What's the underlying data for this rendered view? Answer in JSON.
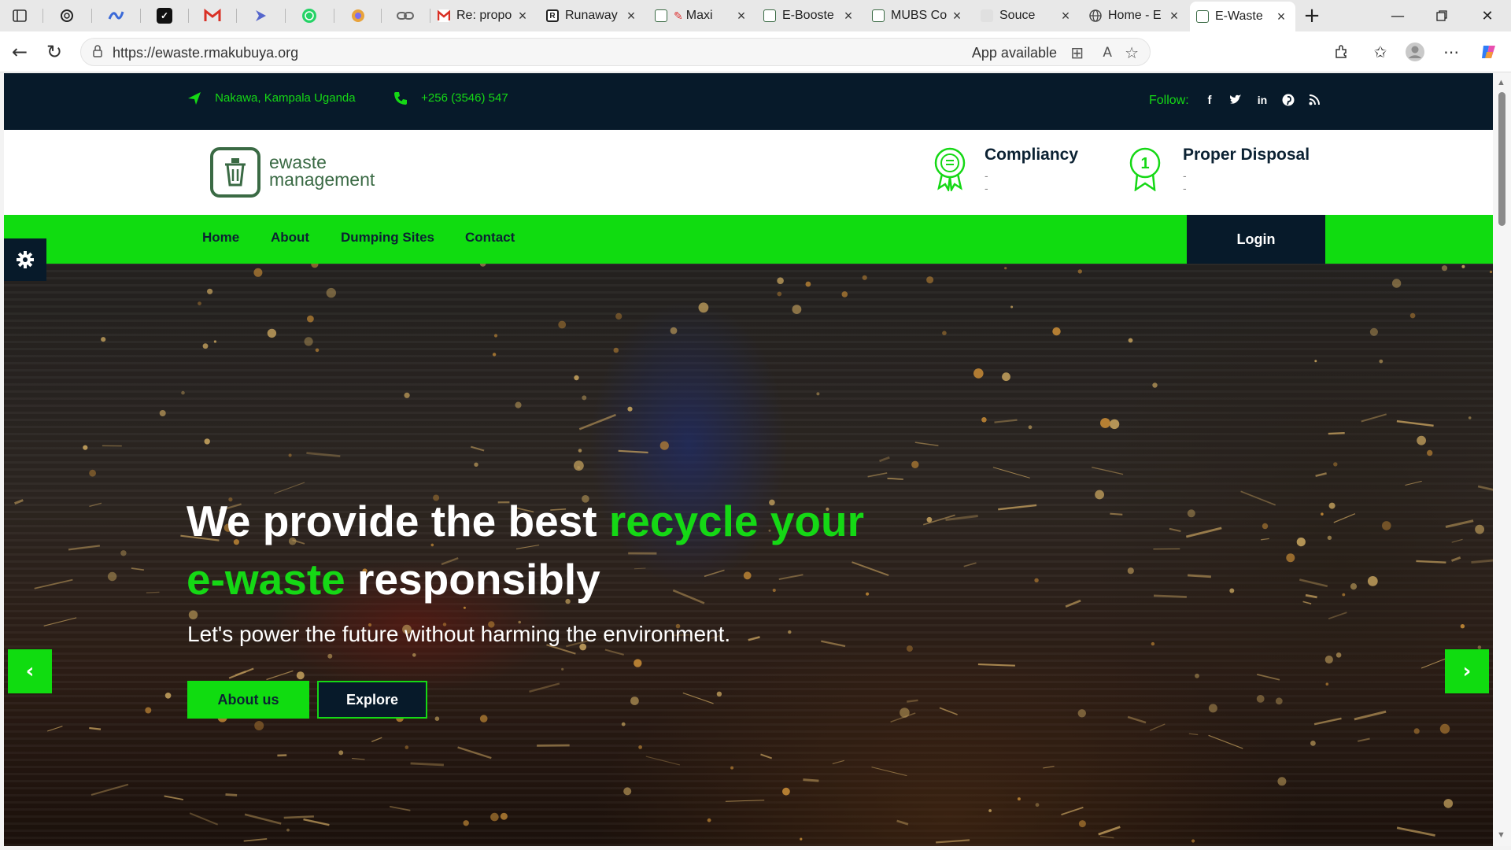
{
  "browser": {
    "pinned_tabs": [
      {
        "icon": "tabs-overview-icon",
        "color": "#444444"
      },
      {
        "icon": "chatgpt-icon",
        "color": "#222222"
      },
      {
        "icon": "copilot-app-icon",
        "color": "#3b6ad8"
      },
      {
        "icon": "ticktick-icon",
        "color": "#111111"
      },
      {
        "icon": "gmail-icon",
        "color": "#d93025"
      },
      {
        "icon": "arrow-app-icon",
        "color": "#5566cc"
      },
      {
        "icon": "whatsapp-icon",
        "color": "#25d366"
      },
      {
        "icon": "colorful-app-icon",
        "color": "#e8a33c"
      },
      {
        "icon": "link-app-icon",
        "color": "#777777"
      }
    ],
    "tabs": [
      {
        "title": "Re: propo",
        "icon": "gmail-icon",
        "color": "#d93025"
      },
      {
        "title": "Runaway",
        "icon": "runaway-icon",
        "color": "#222222"
      },
      {
        "title": "Maxi",
        "icon": "ewaste-favicon",
        "color": "#3a6a44"
      },
      {
        "title": "E-Booste",
        "icon": "ewaste-favicon",
        "color": "#3a6a44"
      },
      {
        "title": "MUBS Co",
        "icon": "ewaste-favicon",
        "color": "#3a6a44"
      },
      {
        "title": "Souce",
        "icon": "page-icon",
        "color": "#bbbbbb"
      },
      {
        "title": "Home - E",
        "icon": "globe-icon",
        "color": "#555555"
      },
      {
        "title": "E-Waste",
        "icon": "ewaste-favicon",
        "color": "#3a6a44",
        "active": true
      }
    ],
    "url": "https://ewaste.rmakubuya.org",
    "app_available": "App available"
  },
  "topbar": {
    "location": "Nakawa, Kampala Uganda",
    "phone": "+256 (3546) 547",
    "follow_label": "Follow:",
    "socials": [
      "facebook-icon",
      "twitter-icon",
      "linkedin-icon",
      "pinterest-icon",
      "rss-icon"
    ]
  },
  "header": {
    "logo_line1": "ewaste",
    "logo_line2": "management",
    "features": [
      {
        "title": "Compliancy",
        "sub": "--"
      },
      {
        "title": "Proper Disposal",
        "sub": "--"
      }
    ]
  },
  "nav": {
    "items": [
      "Home",
      "About",
      "Dumping Sites",
      "Contact"
    ],
    "login": "Login"
  },
  "hero": {
    "title_part1": "We provide the best ",
    "title_highlight": "recycle your e-waste",
    "title_part2": " responsibly",
    "subtitle": "Let's power the future without harming the environment.",
    "btn_about": "About us",
    "btn_explore": "Explore"
  },
  "colors": {
    "accent_green": "#10dc10",
    "dark_navy": "#071a2a",
    "logo_green": "#3a6a44"
  }
}
